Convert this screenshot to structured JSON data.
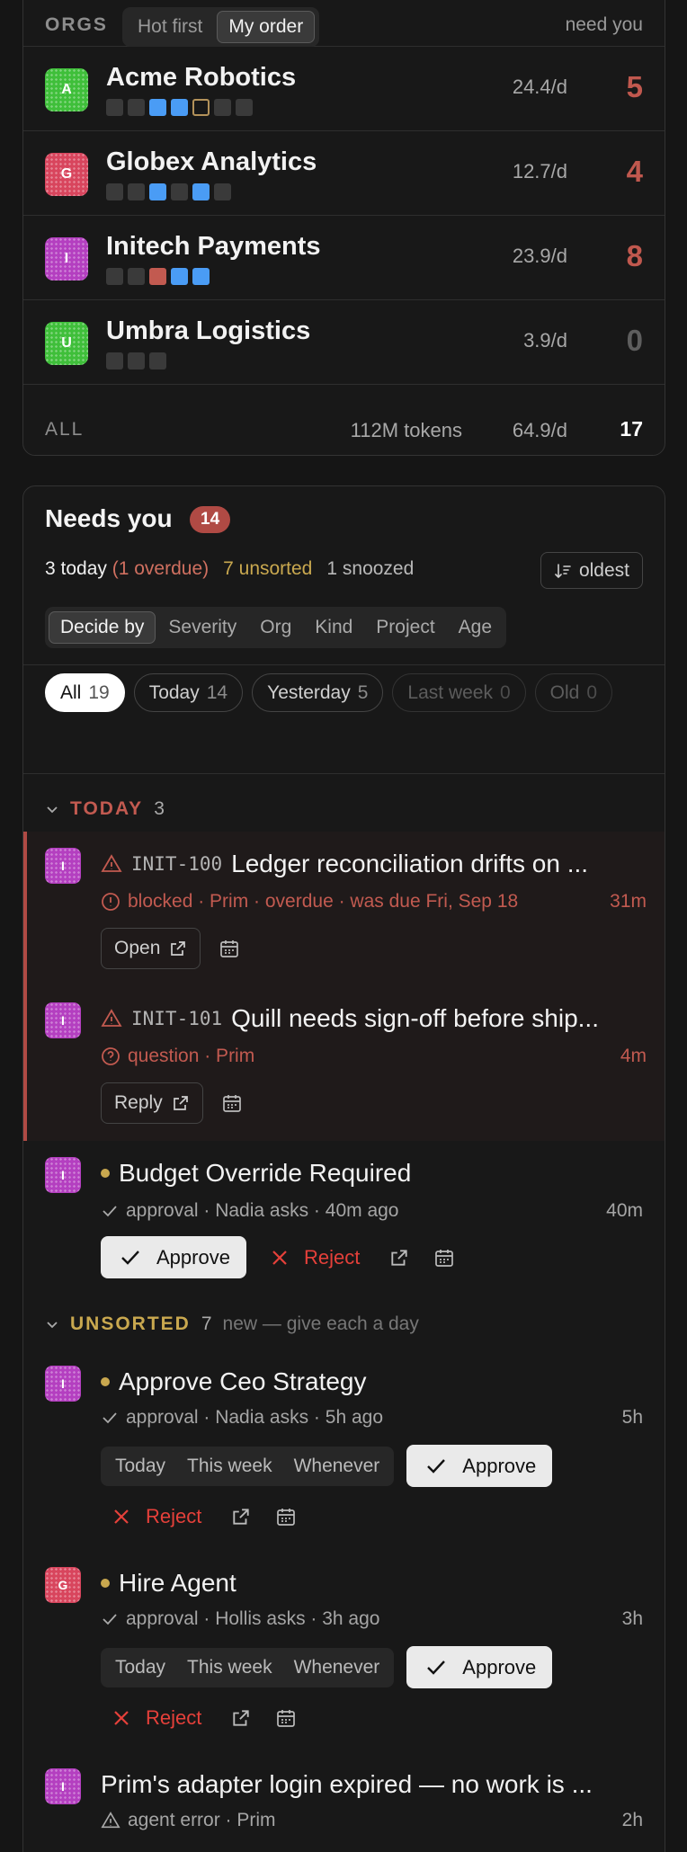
{
  "orgs": {
    "label": "ORGS",
    "sort_options": [
      "Hot first",
      "My order"
    ],
    "sort_active": "My order",
    "need_you_label": "need you",
    "rows": [
      {
        "initial": "A",
        "name": "Acme Robotics",
        "rate": "24.4/d",
        "count": "5",
        "color": "#3fbf3a",
        "squares": [
          "gray",
          "gray",
          "blue",
          "blue",
          "outline",
          "gray",
          "gray"
        ]
      },
      {
        "initial": "G",
        "name": "Globex Analytics",
        "rate": "12.7/d",
        "count": "4",
        "color": "#d8455d",
        "squares": [
          "gray",
          "gray",
          "blue",
          "gray",
          "blue",
          "gray"
        ]
      },
      {
        "initial": "I",
        "name": "Initech Payments",
        "rate": "23.9/d",
        "count": "8",
        "color": "#b43fc0",
        "squares": [
          "gray",
          "gray",
          "red",
          "blue",
          "blue"
        ]
      },
      {
        "initial": "U",
        "name": "Umbra Logistics",
        "rate": "3.9/d",
        "count": "0",
        "color": "#3fbf3a",
        "squares": [
          "gray",
          "gray",
          "gray"
        ]
      }
    ],
    "all": {
      "label": "ALL",
      "tokens": "112M tokens",
      "rate": "64.9/d",
      "count": "17"
    }
  },
  "needs": {
    "title": "Needs you",
    "badge": "14",
    "summary": {
      "today": "3 today",
      "overdue": "(1 overdue)",
      "unsorted": "7 unsorted",
      "snoozed": "1 snoozed"
    },
    "oldest_label": "oldest",
    "decide_by": [
      "Decide by",
      "Severity",
      "Org",
      "Kind",
      "Project",
      "Age"
    ],
    "chips": [
      {
        "label": "All",
        "count": "19"
      },
      {
        "label": "Today",
        "count": "14"
      },
      {
        "label": "Yesterday",
        "count": "5"
      },
      {
        "label": "Last week",
        "count": "0"
      },
      {
        "label": "Old",
        "count": "0"
      }
    ],
    "today_group": {
      "name": "TODAY",
      "count": "3",
      "color": "#c25a50"
    },
    "unsorted_group": {
      "name": "UNSORTED",
      "count": "7",
      "note": "new — give each a day",
      "color": "#c9a84f"
    },
    "items": [
      {
        "code": "INIT-100",
        "title": "Ledger reconciliation drifts on ...",
        "meta": "blocked · Prim  · overdue · was due Fri, Sep 18",
        "age": "31m",
        "action": "Open"
      },
      {
        "code": "INIT-101",
        "title": "Quill needs sign-off before ship...",
        "meta": "question · Prim",
        "age": "4m",
        "action": "Reply"
      },
      {
        "title": "Budget Override Required",
        "meta": "approval · Nadia asks · 40m ago",
        "age": "40m"
      },
      {
        "title": "Approve Ceo Strategy",
        "meta": "approval · Nadia asks · 5h ago",
        "age": "5h"
      },
      {
        "title": "Hire Agent",
        "meta": "approval · Hollis asks · 3h ago",
        "age": "3h"
      },
      {
        "title": "Prim's adapter login expired — no work is ...",
        "meta": "agent error · Prim",
        "age": "2h"
      }
    ],
    "approve_label": "Approve",
    "reject_label": "Reject",
    "when_options": [
      "Today",
      "This week",
      "Whenever"
    ]
  }
}
